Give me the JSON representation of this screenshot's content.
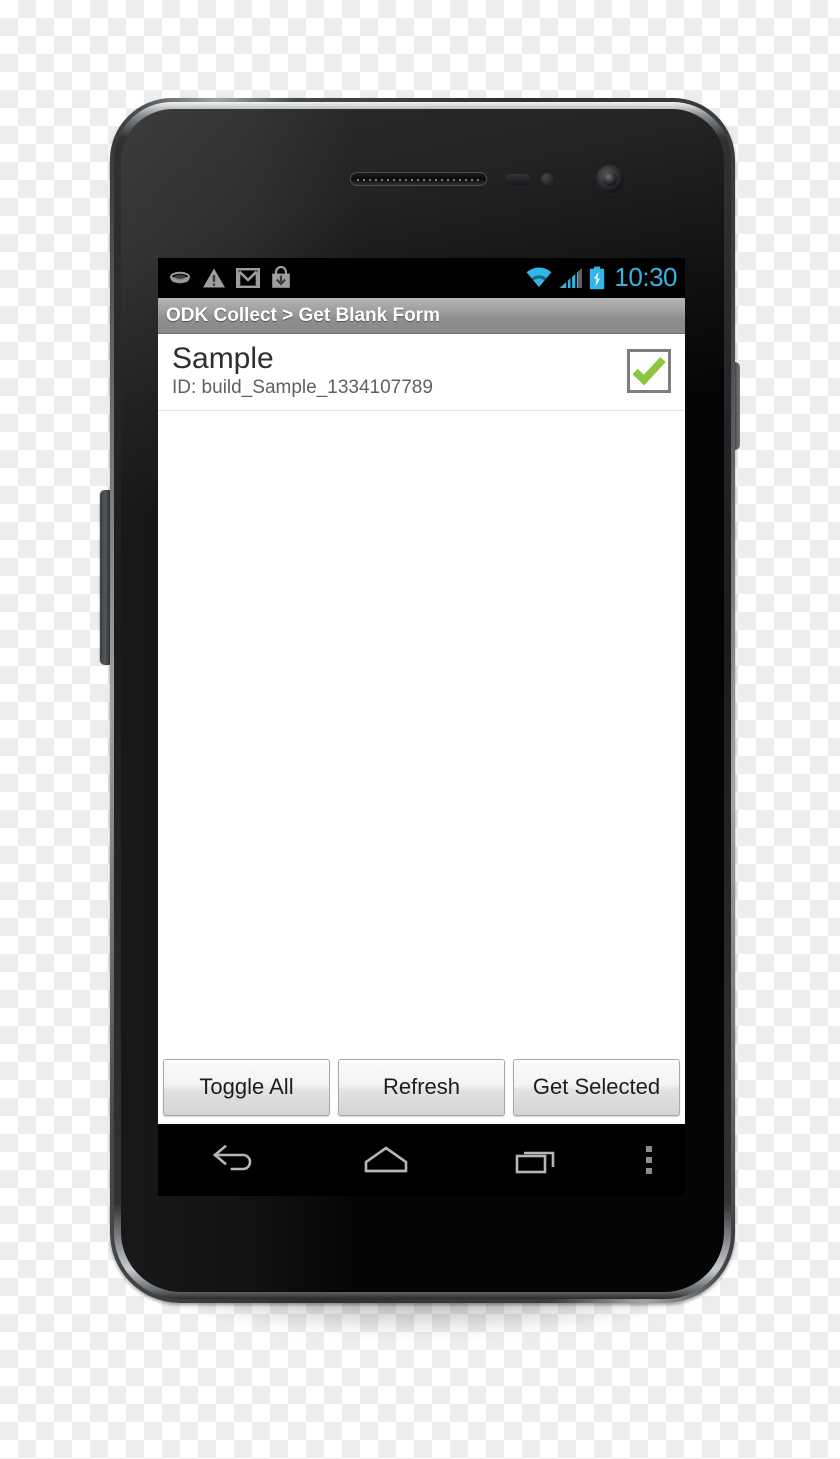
{
  "device": {
    "name": "android-smartphone",
    "hardware": {
      "earpiece": "earpiece-speaker",
      "proximity_sensor": "proximity-sensor",
      "light_sensor": "light-sensor",
      "front_camera": "front-camera",
      "volume_rocker": "volume-rocker",
      "power_button": "power-button"
    }
  },
  "status_bar": {
    "left_icons": [
      {
        "name": "usb-debugging-icon",
        "label": "USB"
      },
      {
        "name": "warning-triangle-icon",
        "label": "Warning"
      },
      {
        "name": "gmail-icon",
        "label": "Gmail"
      },
      {
        "name": "play-store-download-icon",
        "label": "Download"
      }
    ],
    "right_icons": [
      {
        "name": "wifi-icon",
        "label": "Wi-Fi"
      },
      {
        "name": "cellular-signal-icon",
        "label": "Signal"
      },
      {
        "name": "battery-charging-icon",
        "label": "Battery charging"
      }
    ],
    "clock": "10:30",
    "accent_color": "#33b5e5",
    "background_color": "#000000"
  },
  "title_bar": {
    "text": "ODK Collect > Get Blank Form",
    "app_name": "ODK Collect",
    "screen_name": "Get Blank Form"
  },
  "form_list": {
    "rows": [
      {
        "title": "Sample",
        "subtitle": "ID: build_Sample_1334107789",
        "checked": true,
        "check_color": "#8cc63f"
      }
    ]
  },
  "button_bar": {
    "buttons": [
      {
        "name": "toggle-all-button",
        "label": "Toggle All"
      },
      {
        "name": "refresh-button",
        "label": "Refresh"
      },
      {
        "name": "get-selected-button",
        "label": "Get Selected"
      }
    ]
  },
  "nav_bar": {
    "buttons": [
      {
        "name": "nav-back-button",
        "label": "Back"
      },
      {
        "name": "nav-home-button",
        "label": "Home"
      },
      {
        "name": "nav-recents-button",
        "label": "Recent apps"
      },
      {
        "name": "nav-overflow-button",
        "label": "Menu"
      }
    ],
    "icon_color": "#b6b6b6"
  }
}
